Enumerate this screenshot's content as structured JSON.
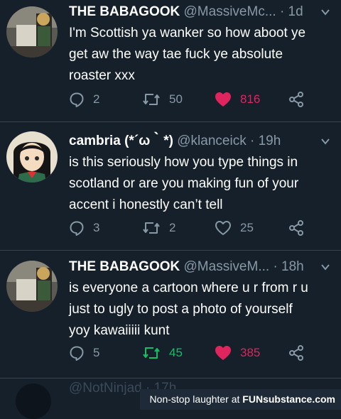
{
  "tweets": [
    {
      "name": "THE BABAGOOK",
      "handle": "@MassiveMc...",
      "time": "· 1d",
      "text_lines": [
        "I'm Scottish ya wanker so how aboot ye",
        "get aw the way tae fuck ye absolute",
        "roaster xxx"
      ],
      "reply_count": "2",
      "retweet_count": "50",
      "like_count": "816",
      "liked": true,
      "retweeted": false
    },
    {
      "name": "cambria (*´ω｀*)",
      "handle": "@klanceick",
      "time": "· 19h",
      "text_lines": [
        "is this seriously how you type things in",
        "scotland or are you making fun of your",
        "accent i honestly can’t tell"
      ],
      "reply_count": "3",
      "retweet_count": "2",
      "like_count": "25",
      "liked": false,
      "retweeted": false
    },
    {
      "name": "THE BABAGOOK",
      "handle": "@MassiveM...",
      "time": "· 18h",
      "text_lines": [
        "is everyone a cartoon where u r from r u",
        "just to ugly to post a photo of yourself",
        "yoy kawaiiiii kunt"
      ],
      "reply_count": "5",
      "retweet_count": "45",
      "like_count": "385",
      "liked": true,
      "retweeted": true
    }
  ],
  "next_tweet_partial": "@NotNinjad · 17h",
  "watermark": {
    "prefix": "Non-stop laughter at",
    "brand": "FUNsubstance.com"
  },
  "colors": {
    "background": "#15202b",
    "muted": "#8899a6",
    "like": "#e0245e",
    "retweet": "#17bf63",
    "divider": "#38444d"
  }
}
